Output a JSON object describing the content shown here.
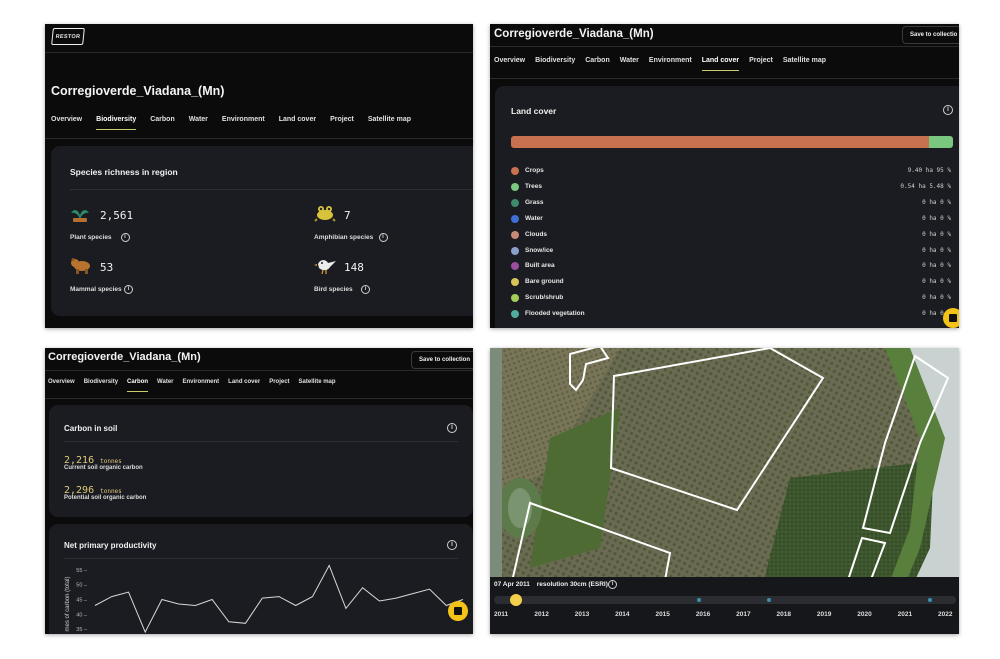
{
  "biodiversity": {
    "logo": "RESTOR",
    "site_title": "Corregioverde_Viadana_(Mn)",
    "tabs": [
      "Overview",
      "Biodiversity",
      "Carbon",
      "Water",
      "Environment",
      "Land cover",
      "Project",
      "Satellite map"
    ],
    "active_tab": "Biodiversity",
    "card_title": "Species richness in region",
    "stats": [
      {
        "count": "2,561",
        "label": "Plant species",
        "icon": "plant-icon"
      },
      {
        "count": "7",
        "label": "Amphibian species",
        "icon": "frog-icon"
      },
      {
        "count": "53",
        "label": "Mammal species",
        "icon": "bear-icon"
      },
      {
        "count": "148",
        "label": "Bird species",
        "icon": "bird-icon"
      }
    ]
  },
  "landcover": {
    "site_title": "Corregioverde_Viadana_(Mn)",
    "save_label": "Save to collectio",
    "tabs": [
      "Overview",
      "Biodiversity",
      "Carbon",
      "Water",
      "Environment",
      "Land cover",
      "Project",
      "Satellite map"
    ],
    "active_tab": "Land cover",
    "card_title": "Land cover",
    "bar_fractions": [
      {
        "color": "#c8714f",
        "value": 0.95
      },
      {
        "color": "#7ac77f",
        "value": 0.0548
      }
    ],
    "items": [
      {
        "label": "Crops",
        "color": "#c8714f",
        "value": "9.40 ha 95 %"
      },
      {
        "label": "Trees",
        "color": "#7ac77f",
        "value": "0.54 ha 5.48 %"
      },
      {
        "label": "Grass",
        "color": "#3f8a6a",
        "value": "0 ha 0 %"
      },
      {
        "label": "Water",
        "color": "#3e6fd4",
        "value": "0 ha 0 %"
      },
      {
        "label": "Clouds",
        "color": "#c58a78",
        "value": "0 ha 0 %"
      },
      {
        "label": "Snow/ice",
        "color": "#8aa0c8",
        "value": "0 ha 0 %"
      },
      {
        "label": "Built area",
        "color": "#9a4e9e",
        "value": "0 ha 0 %"
      },
      {
        "label": "Bare ground",
        "color": "#d6c45a",
        "value": "0 ha 0 %"
      },
      {
        "label": "Scrub/shrub",
        "color": "#a4cc5a",
        "value": "0 ha 0 %"
      },
      {
        "label": "Flooded vegetation",
        "color": "#4fae9e",
        "value": "0 ha 0 %"
      }
    ]
  },
  "carbon": {
    "site_title": "Corregioverde_Viadana_(Mn)",
    "save_label": "Save to collection",
    "tabs": [
      "Overview",
      "Biodiversity",
      "Carbon",
      "Water",
      "Environment",
      "Land cover",
      "Project",
      "Satellite map"
    ],
    "active_tab": "Carbon",
    "soil_title": "Carbon in soil",
    "soil_items": [
      {
        "value": "2,216",
        "unit": "tonnes",
        "label": "Current soil organic carbon"
      },
      {
        "value": "2,296",
        "unit": "tonnes",
        "label": "Potential soil organic carbon"
      }
    ],
    "npp_title": "Net primary productivity",
    "npp_ylabel": "mes of carbon (total)"
  },
  "chart_data": {
    "type": "line",
    "title": "Net primary productivity",
    "ylabel": "mes of carbon (total)",
    "y_ticks": [
      30,
      35,
      40,
      45,
      50,
      55
    ],
    "ylim": [
      30,
      58
    ],
    "values": [
      43,
      46,
      47.5,
      34,
      45,
      43.5,
      43,
      45,
      37.5,
      37,
      45.5,
      46,
      43,
      46,
      56.5,
      42,
      49,
      44.5,
      45.5,
      47,
      48.5,
      43,
      45
    ],
    "line_color": "#d8d8d8"
  },
  "satellite": {
    "date": "07 Apr 2011",
    "resolution": "resolution 30cm (ESRI)",
    "years": [
      "2011",
      "2012",
      "2013",
      "2014",
      "2015",
      "2016",
      "2017",
      "2018",
      "2019",
      "2020",
      "2021",
      "2022"
    ],
    "selected_year_fraction": 0.03
  }
}
